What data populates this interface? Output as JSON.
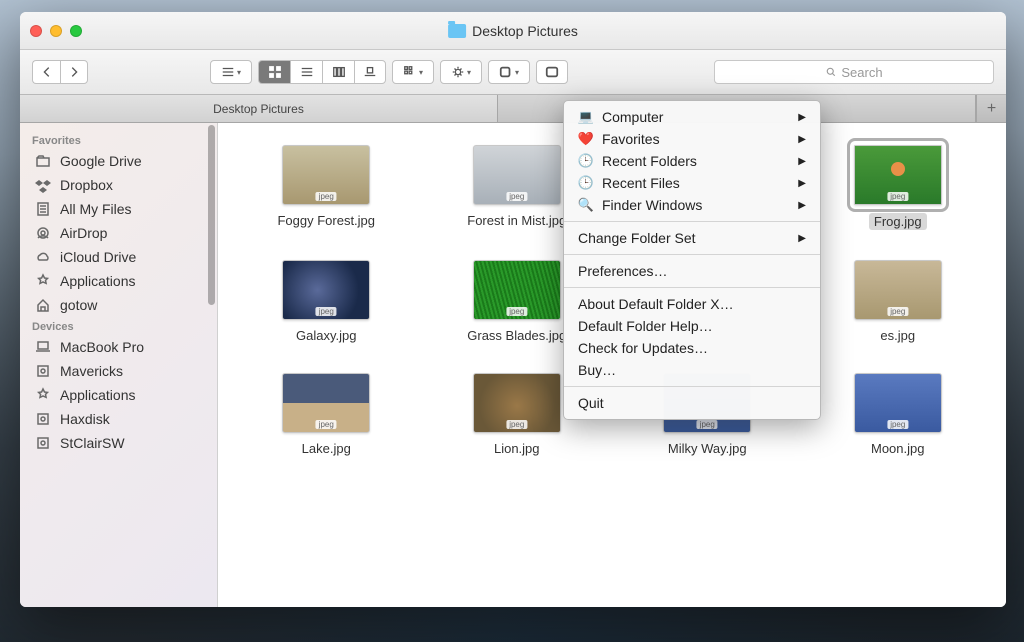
{
  "window": {
    "title": "Desktop Pictures"
  },
  "search": {
    "placeholder": "Search"
  },
  "tabs": [
    "Desktop Pictures",
    ""
  ],
  "sidebar": {
    "sections": [
      {
        "header": "Favorites",
        "items": [
          "Google Drive",
          "Dropbox",
          "All My Files",
          "AirDrop",
          "iCloud Drive",
          "Applications",
          "gotow"
        ]
      },
      {
        "header": "Devices",
        "items": [
          "MacBook Pro",
          "Mavericks",
          "Applications",
          "Haxdisk",
          "StClairSW"
        ]
      }
    ]
  },
  "files": [
    {
      "name": "Foggy Forest.jpg",
      "tint": "t-forest"
    },
    {
      "name": "Forest in Mist.jpg",
      "tint": "t-mist"
    },
    {
      "name": "",
      "tint": ""
    },
    {
      "name": "Frog.jpg",
      "tint": "t-frog",
      "selected": true
    },
    {
      "name": "Galaxy.jpg",
      "tint": "t-galaxy"
    },
    {
      "name": "Grass Blades.jpg",
      "tint": "t-grass"
    },
    {
      "name": "",
      "tint": ""
    },
    {
      "name": "es.jpg",
      "tint": "t-generic",
      "partial": true
    },
    {
      "name": "Lake.jpg",
      "tint": "t-lake"
    },
    {
      "name": "Lion.jpg",
      "tint": "t-lion"
    },
    {
      "name": "Milky Way.jpg",
      "tint": "t-milky"
    },
    {
      "name": "Moon.jpg",
      "tint": "t-moon"
    }
  ],
  "menu": {
    "group1": [
      {
        "icon": "💻",
        "label": "Computer",
        "sub": true
      },
      {
        "icon": "❤️",
        "label": "Favorites",
        "sub": true
      },
      {
        "icon": "🕒",
        "label": "Recent Folders",
        "sub": true
      },
      {
        "icon": "🕒",
        "label": "Recent Files",
        "sub": true
      },
      {
        "icon": "🔍",
        "label": "Finder Windows",
        "sub": true
      }
    ],
    "group2": [
      {
        "label": "Change Folder Set",
        "sub": true
      }
    ],
    "group3": [
      {
        "label": "Preferences…"
      }
    ],
    "group4": [
      {
        "label": "About Default Folder X…"
      },
      {
        "label": "Default Folder Help…"
      },
      {
        "label": "Check for Updates…"
      },
      {
        "label": "Buy…"
      }
    ],
    "group5": [
      {
        "label": "Quit"
      }
    ]
  }
}
